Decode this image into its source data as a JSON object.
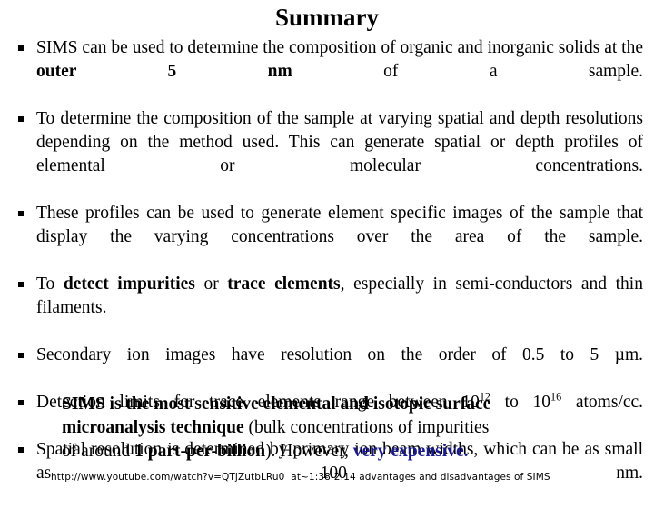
{
  "slide": {
    "title": "Summary",
    "bullet_glyph": "§",
    "accent_color": "#1a1a8c",
    "background_color": "#ffffff",
    "text_color": "#000000"
  },
  "bullets": [
    {
      "id": "bullet-1",
      "parts": [
        {
          "text": "SIMS can be used to determine the composition of organic and inorganic solids at the ",
          "bold": false
        },
        {
          "text": "outer 5 nm",
          "bold": true
        },
        {
          "text": " of a sample.",
          "bold": false
        }
      ],
      "plain": "SIMS can be used to determine the composition of organic and inorganic solids at the outer 5 nm of a sample."
    },
    {
      "id": "bullet-2",
      "parts": [
        {
          "text": "To determine the composition of the sample at varying spatial and depth resolutions depending on the method used.  This can generate spatial or depth profiles of elemental or molecular concentrations.",
          "bold": false
        }
      ],
      "plain": "To determine the composition of the sample at varying spatial and depth resolutions depending on the method used.  This can generate spatial or depth profiles of elemental or molecular concentrations."
    },
    {
      "id": "bullet-3",
      "parts": [
        {
          "text": "These profiles can be used to generate element specific images of the sample that display the varying concentrations over the area of the sample.",
          "bold": false
        }
      ],
      "plain": "These profiles can be used to generate element specific images of the sample that display the varying concentrations over the area of the sample."
    },
    {
      "id": "bullet-4",
      "parts": [
        {
          "text": "To ",
          "bold": false
        },
        {
          "text": "detect impurities",
          "bold": true
        },
        {
          "text": " or ",
          "bold": false
        },
        {
          "text": "trace elements",
          "bold": true
        },
        {
          "text": ", especially in semi-conductors and thin filaments.",
          "bold": false
        }
      ],
      "plain": "To detect impurities or trace elements, especially in semi-conductors and thin filaments."
    },
    {
      "id": "bullet-5",
      "parts": [
        {
          "text": "Secondary ion images have resolution on the order of 0.5 to 5 µm.",
          "bold": false
        }
      ],
      "plain": "Secondary ion images have resolution on the order of 0.5 to 5 µm."
    },
    {
      "id": "bullet-6",
      "parts": [
        {
          "text": "Detection limits for trace elements range between 10",
          "bold": false
        },
        {
          "text": "12",
          "bold": false,
          "sup": true
        },
        {
          "text": "  to 10",
          "bold": false
        },
        {
          "text": "16",
          "bold": false,
          "sup": true
        },
        {
          "text": " atoms/cc.",
          "bold": false
        }
      ],
      "plain": "Detection limits for trace elements range between 10^12 to 10^16 atoms/cc."
    },
    {
      "id": "bullet-7",
      "parts": [
        {
          "text": "Spatial resolution is determined by primary ion beam widths, which can be as small as 100 nm.",
          "bold": false
        }
      ],
      "plain": "Spatial resolution is determined by primary ion beam widths, which can be as small as 100 nm."
    }
  ],
  "closing": {
    "line1_bold": "SIMS is the most sensitive elemental and isotopic surface",
    "line2_bold": "microanalysis technique",
    "line2_rest": " (bulk concentrations of impurities",
    "line3_lead": "of around ",
    "line3_bold": "1 part-per-billion",
    "line3_mid": ").   However, ",
    "line3_accent": "very expensive."
  },
  "footnote": {
    "url": "http://www.youtube.com/watch?v=QTjZutbLRu0",
    "note": "at~1:38-2:14 advantages and disadvantages of SIMS"
  }
}
